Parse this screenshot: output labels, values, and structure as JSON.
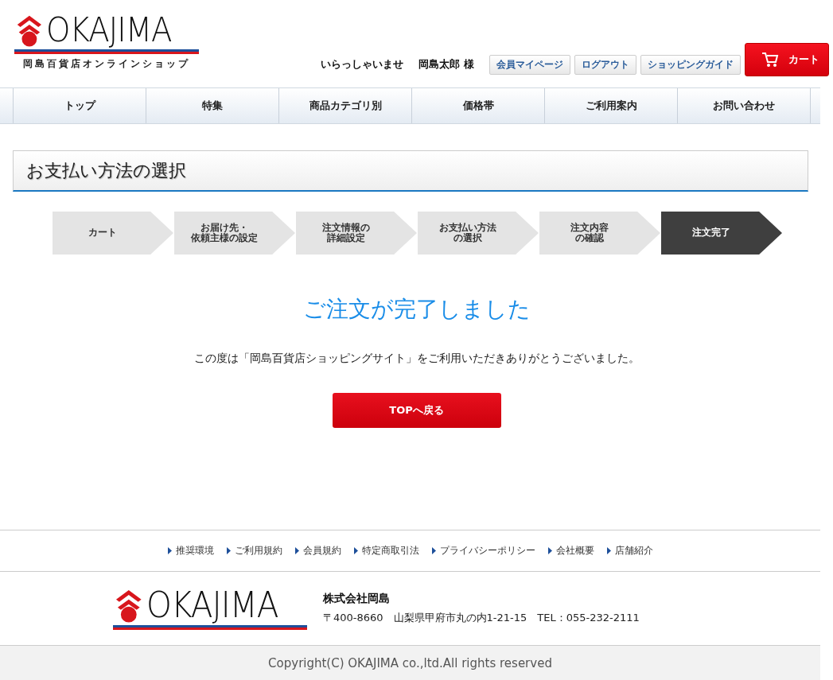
{
  "header": {
    "logo_text": "OKAJIMA",
    "logo_subtitle": "岡島百貨店オンラインショップ",
    "greeting": "いらっしゃいませ",
    "user_name": "岡島太郎 様",
    "links": [
      "会員マイページ",
      "ログアウト",
      "ショッピングガイド"
    ],
    "cart_button": "カート"
  },
  "nav": {
    "items": [
      {
        "label": "トップ"
      },
      {
        "label": "特集"
      },
      {
        "label": "商品カテゴリ別"
      },
      {
        "label": "価格帯"
      },
      {
        "label": "ご利用案内"
      },
      {
        "label": "お問い合わせ"
      }
    ]
  },
  "page_title": "お支払い方法の選択",
  "steps": [
    {
      "lines": [
        "カート"
      ],
      "selected": false
    },
    {
      "lines": [
        "お届け先・",
        "依頼主様の設定"
      ],
      "selected": false
    },
    {
      "lines": [
        "注文情報の",
        "詳細設定"
      ],
      "selected": false
    },
    {
      "lines": [
        "お支払い方法",
        "の選択"
      ],
      "selected": false
    },
    {
      "lines": [
        "注文内容",
        "の確認"
      ],
      "selected": false
    },
    {
      "lines": [
        "注文完了"
      ],
      "selected": true
    }
  ],
  "completion": {
    "heading": "ご注文が完了しました",
    "message": "この度は「岡島百貨店ショッピングサイト」をご利用いただきありがとうございました。",
    "button": "TOPへ戻る"
  },
  "footer": {
    "links": [
      "推奨環境",
      "ご利用規約",
      "会員規約",
      "特定商取引法",
      "プライバシーポリシー",
      "会社概要",
      "店舗紹介"
    ],
    "logo_text": "OKAJIMA",
    "company": "株式会社岡島",
    "address": "〒400-8660　山梨県甲府市丸の内1-21-15　TEL：055-232-2111",
    "copyright": "Copyright(C) OKAJIMA co.,ltd.All rights reserved"
  }
}
